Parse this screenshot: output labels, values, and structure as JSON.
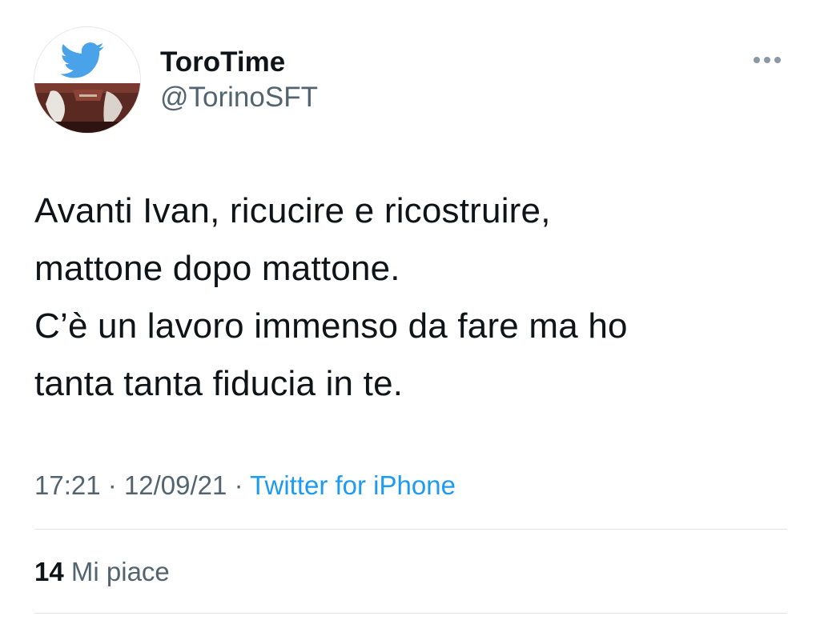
{
  "author": {
    "display_name": "ToroTime",
    "handle": "@TorinoSFT",
    "avatar_icon": "twitter-bird-over-jersey-avatar"
  },
  "tweet": {
    "text": "Avanti Ivan, ricucire e ricostruire,\nmattone dopo mattone.\nC’è un lavoro immenso da fare ma ho\ntanta tanta fiducia in te."
  },
  "meta": {
    "time": "17:21",
    "separator": "·",
    "date": "12/09/21",
    "source": "Twitter for iPhone"
  },
  "engagement": {
    "likes_count": "14",
    "likes_label": "Mi piace"
  },
  "colors": {
    "text_primary": "#0f1419",
    "text_secondary": "#536471",
    "accent": "#1d9bf0",
    "divider": "#dfe3e6"
  },
  "icons": {
    "more": "more-horizontal-icon"
  }
}
